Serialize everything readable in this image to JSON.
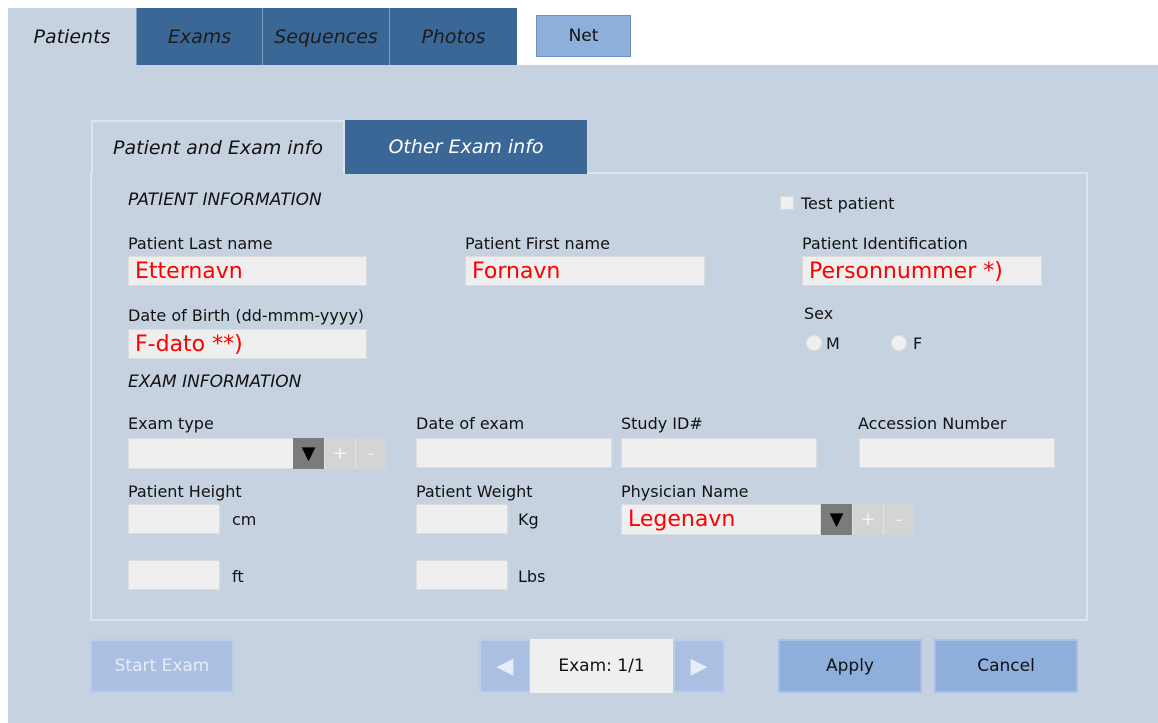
{
  "top_tabs": [
    {
      "label": "Patients",
      "active": true
    },
    {
      "label": "Exams",
      "active": false
    },
    {
      "label": "Sequences",
      "active": false
    },
    {
      "label": "Photos",
      "active": false
    }
  ],
  "net_button": "Net",
  "sub_tabs": [
    {
      "label": "Patient and Exam info",
      "active": true
    },
    {
      "label": "Other Exam info",
      "active": false
    }
  ],
  "patient": {
    "section_title": "PATIENT INFORMATION",
    "test_patient_label": "Test patient",
    "last_name_label": "Patient Last name",
    "last_name_value": "Etternavn",
    "first_name_label": "Patient First name",
    "first_name_value": "Fornavn",
    "id_label": "Patient Identification",
    "id_value": "Personnummer *)",
    "dob_label": "Date of Birth (dd-mmm-yyyy)",
    "dob_value": "F-dato **)",
    "sex_label": "Sex",
    "sex_m": "M",
    "sex_f": "F"
  },
  "exam": {
    "section_title": "EXAM INFORMATION",
    "exam_type_label": "Exam type",
    "date_label": "Date of exam",
    "study_id_label": "Study ID#",
    "accession_label": "Accession Number",
    "height_label": "Patient Height",
    "height_unit_cm": "cm",
    "height_unit_ft": "ft",
    "weight_label": "Patient Weight",
    "weight_unit_kg": "Kg",
    "weight_unit_lbs": "Lbs",
    "physician_label": "Physician Name",
    "physician_value": "Legenavn",
    "dropdown_arrow": "▼",
    "plus": "+",
    "minus": "-"
  },
  "footer": {
    "start_exam": "Start Exam",
    "prev_arrow": "◀",
    "exam_counter": "Exam: 1/1",
    "next_arrow": "▶",
    "apply": "Apply",
    "cancel": "Cancel"
  },
  "colors": {
    "panel_bg": "#c7d2e1",
    "tab_inactive": "#3a6796",
    "button_primary": "#8eaedc",
    "field_value_red": "#ff0000"
  }
}
